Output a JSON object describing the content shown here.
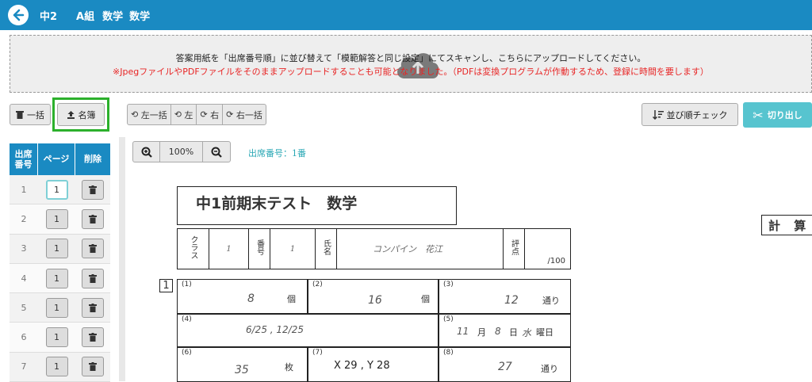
{
  "header": {
    "grade": "中2",
    "group": "A組",
    "subject1": "数学",
    "subject2": "数学"
  },
  "upload": {
    "line1": "答案用紙を「出席番号順」に並び替えて「模範解答と同じ設定」にてスキャンし、こちらにアップロードしてください。",
    "line2": "※JpegファイルやPDFファイルをそのままアップロードすることも可能となりました。（PDFは変換プログラムが作動するため、登録に時間を要します）"
  },
  "toolbar": {
    "delete_all": "一括",
    "roster": "名簿",
    "rot_left_all": "左一括",
    "rot_left": "左",
    "rot_right": "右",
    "rot_right_all": "右一括",
    "order_check": "並び順チェック",
    "cut": "切り出し"
  },
  "table": {
    "headers": [
      "出席\n番号",
      "ページ",
      "削除"
    ],
    "rows": [
      {
        "no": "1",
        "page": "1"
      },
      {
        "no": "2",
        "page": "1"
      },
      {
        "no": "3",
        "page": "1"
      },
      {
        "no": "4",
        "page": "1"
      },
      {
        "no": "5",
        "page": "1"
      },
      {
        "no": "6",
        "page": "1"
      },
      {
        "no": "7",
        "page": "1"
      }
    ]
  },
  "viewer": {
    "zoom": "100%",
    "seat_label": "出席番号：1番"
  },
  "sheet": {
    "title": "中1前期末テスト　数学",
    "calc": "計 算",
    "class_label": "クラス",
    "class_value": "1",
    "num_label": "番号",
    "num_value": "1",
    "name_label": "氏名",
    "name_value": "コンパイン　花江",
    "score_label": "評点",
    "score_max": "/100",
    "q": "1",
    "answers": [
      {
        "n": "(1)",
        "v": "8",
        "u": "個"
      },
      {
        "n": "(2)",
        "v": "16",
        "u": "個"
      },
      {
        "n": "(3)",
        "v": "12",
        "u": "通り"
      },
      {
        "n": "(4)",
        "v": "6/25 , 12/25",
        "u": ""
      },
      {
        "n": "(5)",
        "v1": "11",
        "u1": "月",
        "v2": "8",
        "u2": "日",
        "v3": "水",
        "u3": "曜日"
      },
      {
        "n": "(6)",
        "v": "35",
        "u": "枚"
      },
      {
        "n": "(7)",
        "v": "X 29 , Y 28",
        "u": ""
      },
      {
        "n": "(8)",
        "v": "27",
        "u": "通り"
      }
    ]
  }
}
